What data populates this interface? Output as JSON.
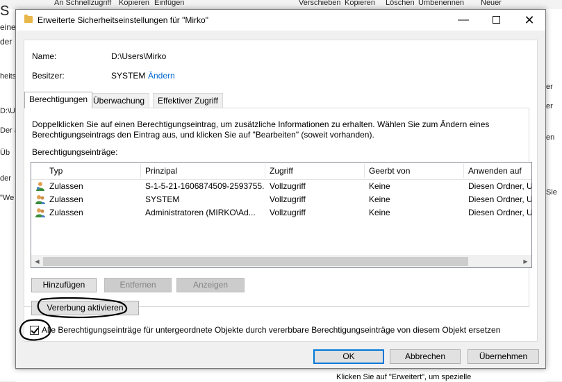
{
  "background": {
    "ribbon": [
      "An Schnellzugriff",
      "Kopieren",
      "Einfügen",
      "Verschieben",
      "Kopieren",
      "Löschen",
      "Umbenennen",
      "Neuer"
    ],
    "left_fragments": [
      "S",
      "eine",
      "der",
      "heits",
      "D:\\U",
      "Der a",
      "Üb",
      "der",
      "\"We"
    ],
    "right_fragments": [
      "er",
      "er",
      "en",
      "Sie"
    ],
    "bottom_hint": "Klicken Sie auf \"Erweitert\", um spezielle"
  },
  "dialog": {
    "title": "Erweiterte Sicherheitseinstellungen für \"Mirko\"",
    "name_label": "Name:",
    "name_value": "D:\\Users\\Mirko",
    "owner_label": "Besitzer:",
    "owner_value": "SYSTEM",
    "owner_change_link": "Ändern",
    "tabs": [
      {
        "label": "Berechtigungen",
        "active": true
      },
      {
        "label": "Überwachung",
        "active": false
      },
      {
        "label": "Effektiver Zugriff",
        "active": false
      }
    ],
    "instructions_line1": "Doppelklicken Sie auf einen Berechtigungseintrag, um zusätzliche Informationen zu erhalten. Wählen Sie zum Ändern eines",
    "instructions_line2": "Berechtigungseintrags den Eintrag aus, und klicken Sie auf \"Bearbeiten\" (soweit vorhanden).",
    "entries_label": "Berechtigungseinträge:",
    "columns": [
      "Typ",
      "Prinzipal",
      "Zugriff",
      "Geerbt von",
      "Anwenden auf"
    ],
    "rows": [
      {
        "type": "Zulassen",
        "principal": "S-1-5-21-1606874509-2593755...",
        "access": "Vollzugriff",
        "inherited": "Keine",
        "applies": "Diesen Ordner, Ur"
      },
      {
        "type": "Zulassen",
        "principal": "SYSTEM",
        "access": "Vollzugriff",
        "inherited": "Keine",
        "applies": "Diesen Ordner, Ur"
      },
      {
        "type": "Zulassen",
        "principal": "Administratoren (MIRKO\\Ad...",
        "access": "Vollzugriff",
        "inherited": "Keine",
        "applies": "Diesen Ordner, Ur"
      }
    ],
    "buttons": {
      "add": "Hinzufügen",
      "remove": "Entfernen",
      "view": "Anzeigen",
      "enable_inheritance": "Vererbung aktivieren",
      "ok": "OK",
      "cancel": "Abbrechen",
      "apply": "Übernehmen"
    },
    "replace_checkbox_label": "Alle Berechtigungseinträge für untergeordnete Objekte durch vererbbare Berechtigungseinträge von diesem Objekt ersetzen",
    "replace_checkbox_checked": true
  },
  "colors": {
    "link": "#0066cc",
    "default_button_border": "#0078d7",
    "annotation": "#000000"
  }
}
